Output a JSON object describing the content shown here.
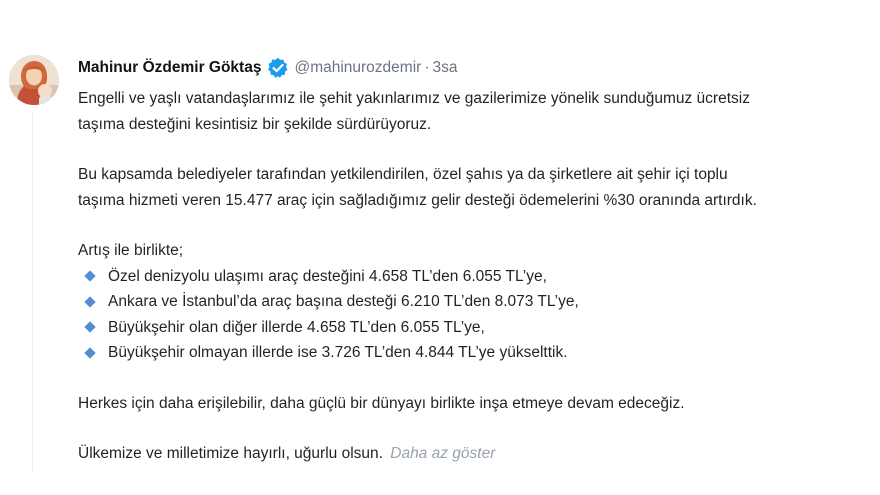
{
  "post": {
    "author": {
      "display_name": "Mahinur Özdemir Göktaş",
      "handle": "@mahinurozdemir",
      "separator": "·",
      "time": "3sa",
      "verified": true,
      "verified_color": "#1d9bf0"
    },
    "paragraphs": [
      "Engelli ve yaşlı vatandaşlarımız ile şehit yakınlarımız ve gazilerimize yönelik sunduğumuz ücretsiz",
      "taşıma desteğini kesintisiz bir şekilde sürdürüyoruz.",
      "Bu kapsamda belediyeler tarafından yetkilendirilen, özel şahıs ya da şirketlere ait şehir içi toplu",
      "taşıma hizmeti veren 15.477 araç için sağladığımız gelir desteği ödemelerini %30 oranında artırdık.",
      "Artış ile birlikte;"
    ],
    "bullets": [
      "Özel denizyolu ulaşımı araç desteğini 4.658 TL’den 6.055 TL’ye,",
      "Ankara ve İstanbul’da araç başına desteği 6.210 TL’den 8.073 TL’ye,",
      "Büyükşehir olan diğer illerde 4.658 TL’den 6.055 TL’ye,",
      "Büyükşehir olmayan illerde ise 3.726 TL’den 4.844 TL’ye yükselttik."
    ],
    "closing": [
      "Herkes için daha erişilebilir, daha güçlü bir dünyayı birlikte inşa etmeye devam edeceğiz.",
      "Ülkemize ve milletimize hayırlı, uğurlu olsun."
    ],
    "show_less_label": "Daha az göster",
    "bullet_icon": "diamond-icon",
    "bullet_color": "#4f8fcf",
    "link_muted_color": "#98a2ad"
  }
}
